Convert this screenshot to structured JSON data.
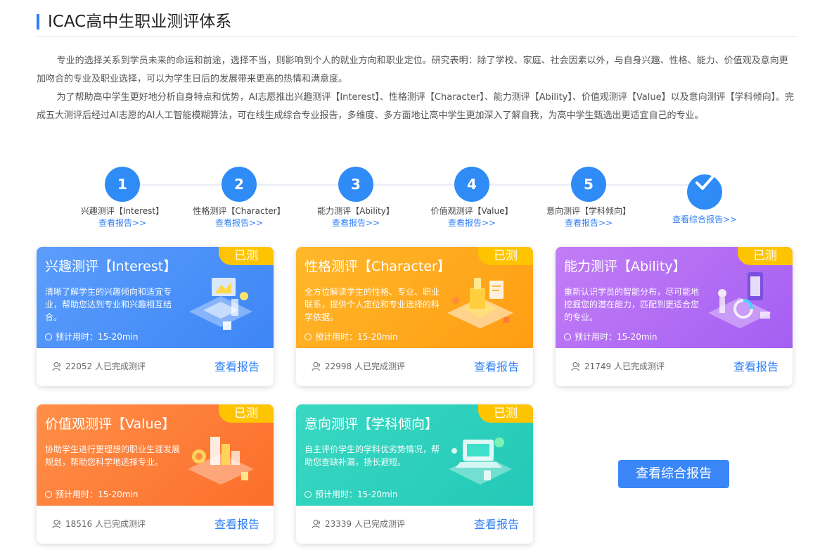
{
  "page": {
    "title": "ICAC高中生职业测评体系",
    "intro": [
      "专业的选择关系到学员未来的命运和前途，选择不当，则影响到个人的就业方向和职业定位。研究表明：除了学校、家庭、社会因素以外，与自身兴趣、性格、能力、价值观及意向更加吻合的专业及职业选择，可以为学生日后的发展带来更高的热情和满意度。",
      "为了帮助高中学生更好地分析自身特点和优势，AI志愿推出兴趣测评【Interest】、性格测评【Character】、能力测评【Ability】、价值观测评【Value】以及意向测评【学科倾向】。完成五大测评后经过AI志愿的AI人工智能模糊算法，可在线生成综合专业报告，多维度、多方面地让高中学生更加深入了解自我，为高中学生甄选出更适宜自己的专业。"
    ]
  },
  "steps": [
    {
      "num": "1",
      "label": "兴趣测评【Interest】",
      "link": "查看报告>>"
    },
    {
      "num": "2",
      "label": "性格测评【Character】",
      "link": "查看报告>>"
    },
    {
      "num": "3",
      "label": "能力测评【Ability】",
      "link": "查看报告>>"
    },
    {
      "num": "4",
      "label": "价值观测评【Value】",
      "link": "查看报告>>"
    },
    {
      "num": "5",
      "label": "意向测评【学科倾向】",
      "link": "查看报告>>"
    },
    {
      "num": "",
      "label": "",
      "link": "查看综合报告>>"
    }
  ],
  "cards": [
    {
      "badge": "已测",
      "title": "兴趣测评【Interest】",
      "desc": "清晰了解学生的兴趣倾向和适宜专业，帮助您达到专业和兴趣相互结合。",
      "time": "预计用时：15-20min",
      "count": "22052 人已完成测评",
      "report": "查看报告",
      "color": "#3e86f6",
      "icon": "interest-illustration"
    },
    {
      "badge": "已测",
      "title": "性格测评【Character】",
      "desc": "全方位解读学生的性格、专业、职业联系，提供个人定位和专业选择的科学依据。",
      "time": "预计用时：15-20min",
      "count": "22998 人已完成测评",
      "report": "查看报告",
      "color": "#ff9d13",
      "icon": "character-illustration"
    },
    {
      "badge": "已测",
      "title": "能力测评【Ability】",
      "desc": "重新认识学员的智能分布，尽可能地挖掘您的潜在能力，匹配到更适合您的专业。",
      "time": "预计用时：15-20min",
      "count": "21749 人已完成测评",
      "report": "查看报告",
      "color": "#a45ff2",
      "icon": "ability-illustration"
    },
    {
      "badge": "已测",
      "title": "价值观测评【Value】",
      "desc": "协助学生进行更理想的职业生涯发展规划，帮助您科学地选择专业。",
      "time": "预计用时：15-20min",
      "count": "18516 人已完成测评",
      "report": "查看报告",
      "color": "#fb6e2b",
      "icon": "value-illustration"
    },
    {
      "badge": "已测",
      "title": "意向测评【学科倾向】",
      "desc": "自主评价学生的学科优劣势情况，帮助您查缺补漏，扬长避短。",
      "time": "预计用时：15-20min",
      "count": "23339 人已完成测评",
      "report": "查看报告",
      "color": "#22c9b6",
      "icon": "intention-illustration"
    }
  ],
  "overall_button": "查看综合报告"
}
